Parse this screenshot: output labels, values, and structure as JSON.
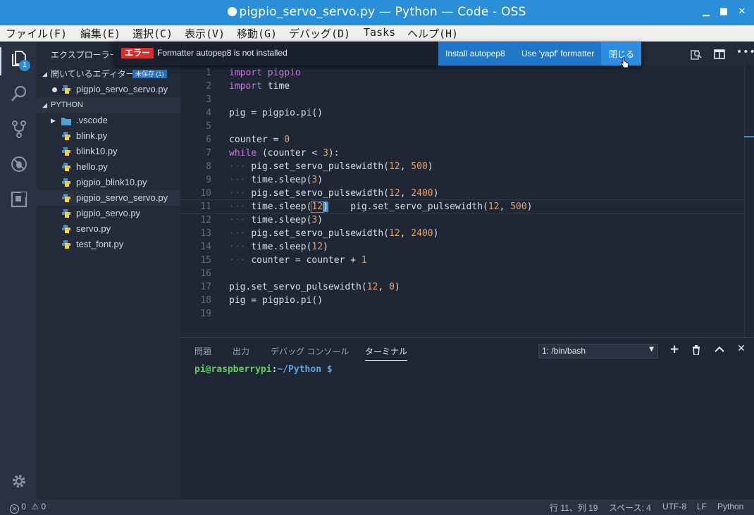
{
  "window": {
    "title": "pigpio_servo_servo.py — Python — Code - OSS"
  },
  "menu": [
    "ファイル(F)",
    "編集(E)",
    "選択(C)",
    "表示(V)",
    "移動(G)",
    "デバッグ(D)",
    "Tasks",
    "ヘルプ(H)"
  ],
  "activity": {
    "explorer_badge": "1"
  },
  "sidebar": {
    "title": "エクスプローラー",
    "open_editors_header": "開いているエディター",
    "unsaved_badge": "未保存 (1)",
    "open_editor_file": "pigpio_servo_servo.py",
    "folder_header": "PYTHON",
    "folder": ".vscode",
    "files": [
      "blink.py",
      "blink10.py",
      "hello.py",
      "pigpio_blink10.py",
      "pigpio_servo_servo.py",
      "pigpio_servo.py",
      "servo.py",
      "test_font.py"
    ]
  },
  "notification": {
    "badge": "エラー",
    "message": "Formatter autopep8 is not installed",
    "action1": "Install autopep8",
    "action2": "Use 'yapf' formatter",
    "close": "閉じる"
  },
  "editor": {
    "line_numbers": [
      "1",
      "2",
      "3",
      "4",
      "5",
      "6",
      "7",
      "8",
      "9",
      "10",
      "11",
      "12",
      "13",
      "14",
      "15",
      "16",
      "17",
      "18",
      "19"
    ],
    "code": {
      "l1": "import pigpio",
      "l2_kw": "import",
      "l2_rest": " time",
      "l4": "pig = pigpio.pi()",
      "l6_a": "counter = ",
      "l6_b": "0",
      "l7_kw": "while",
      "l7_a": " (counter < ",
      "l7_b": "3",
      "l7_c": "):",
      "l8_a": "pig.set_servo_pulsewidth(",
      "l8_b": "12",
      "l8_c": ", ",
      "l8_d": "500",
      "l8_e": ")",
      "l9_a": "time.sleep(",
      "l9_b": "3",
      "l9_c": ")",
      "l10_a": "pig.set_servo_pulsewidth(",
      "l10_b": "12",
      "l10_c": ", ",
      "l10_d": "2400",
      "l10_e": ")",
      "l11_a": "time.sleep(",
      "l11_b": "12",
      "l11_c": ")",
      "l11_d": "    pig.set_servo_pulsewidth(",
      "l11_e": "12",
      "l11_f": ", ",
      "l11_g": "500",
      "l11_h": ")",
      "l12_a": "time.sleep(",
      "l12_b": "3",
      "l12_c": ")",
      "l13_a": "pig.set_servo_pulsewidth(",
      "l13_b": "12",
      "l13_c": ", ",
      "l13_d": "2400",
      "l13_e": ")",
      "l14_a": "time.sleep(",
      "l14_b": "12",
      "l14_c": ")",
      "l15_a": "counter = counter + ",
      "l15_b": "1",
      "l17_a": "pig.set_servo_pulsewidth(",
      "l17_b": "12",
      "l17_c": ", ",
      "l17_d": "0",
      "l17_e": ")",
      "l18": "pig = pigpio.pi()",
      "indent": "···"
    }
  },
  "panel": {
    "tabs": [
      "問題",
      "出力",
      "デバッグ コンソール",
      "ターミナル"
    ],
    "terminal_select": "1: /bin/bash",
    "prompt_user": "pi@raspberrypi",
    "prompt_sep": ":",
    "prompt_path": "~/Python $"
  },
  "status": {
    "errors": "0",
    "warnings": "0",
    "position": "行 11、列 19",
    "spaces": "スペース: 4",
    "encoding": "UTF-8",
    "eol": "LF",
    "language": "Python"
  },
  "colors": {
    "accent": "#2b8ed8",
    "error": "#d32f2f",
    "notif_action": "#1f76c7"
  }
}
